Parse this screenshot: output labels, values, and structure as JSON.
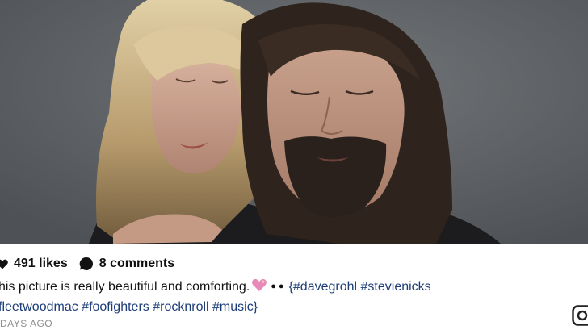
{
  "post": {
    "likes": "491 likes",
    "comments": "8 comments",
    "caption_line1": "his picture is really beautiful and comforting.",
    "caption_line1_tags": "{#davegrohl #stevienicks",
    "caption_line2": "fleetwoodmac #foofighters #rocknroll #music}",
    "timestamp": "DAYS AGO"
  },
  "icons": {
    "like": "heart-icon",
    "comment": "speech-bubble-icon",
    "emoji": "sparkling-heart-emoji",
    "share": "camera-icon"
  },
  "colors": {
    "photo_background": "#5d6165",
    "hashtag": "#1e3d78",
    "timestamp": "#8e8e8e",
    "emoji": "#e889b8"
  }
}
